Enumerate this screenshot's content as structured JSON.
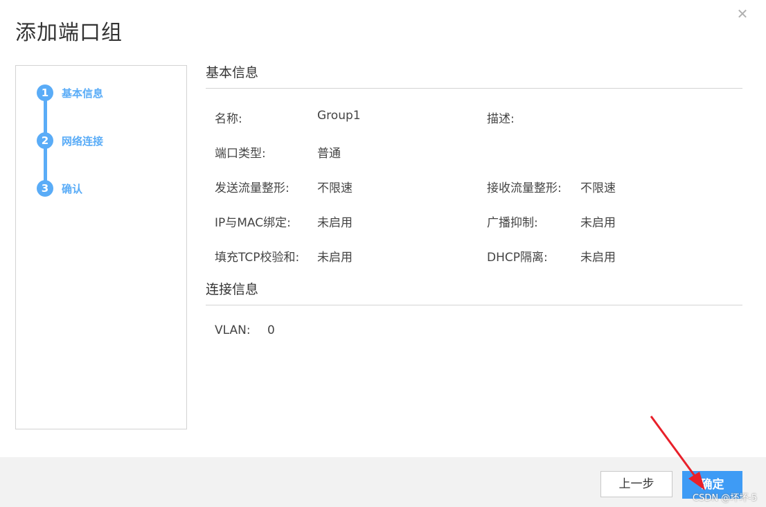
{
  "dialog": {
    "title": "添加端口组",
    "close_icon": "close-icon"
  },
  "steps": [
    {
      "number": "1",
      "label": "基本信息"
    },
    {
      "number": "2",
      "label": "网络连接"
    },
    {
      "number": "3",
      "label": "确认"
    }
  ],
  "basic_info": {
    "section_title": "基本信息",
    "fields": {
      "name": {
        "label": "名称:",
        "value": "Group1"
      },
      "description": {
        "label": "描述:",
        "value": ""
      },
      "port_type": {
        "label": "端口类型:",
        "value": "普通"
      },
      "tx_shaping": {
        "label": "发送流量整形:",
        "value": "不限速"
      },
      "rx_shaping": {
        "label": "接收流量整形:",
        "value": "不限速"
      },
      "ip_mac_binding": {
        "label": "IP与MAC绑定:",
        "value": "未启用"
      },
      "broadcast_suppression": {
        "label": "广播抑制:",
        "value": "未启用"
      },
      "tcp_checksum": {
        "label": "填充TCP校验和:",
        "value": "未启用"
      },
      "dhcp_isolation": {
        "label": "DHCP隔离:",
        "value": "未启用"
      }
    }
  },
  "connection_info": {
    "section_title": "连接信息",
    "vlan": {
      "label": "VLAN:",
      "value": "0"
    }
  },
  "footer": {
    "prev_label": "上一步",
    "ok_label": "确定"
  },
  "watermark": "CSDN @坏坏-5",
  "colors": {
    "accent": "#5aacf7",
    "primary_button": "#3e9bf5",
    "annotation_arrow": "#e8202a"
  }
}
